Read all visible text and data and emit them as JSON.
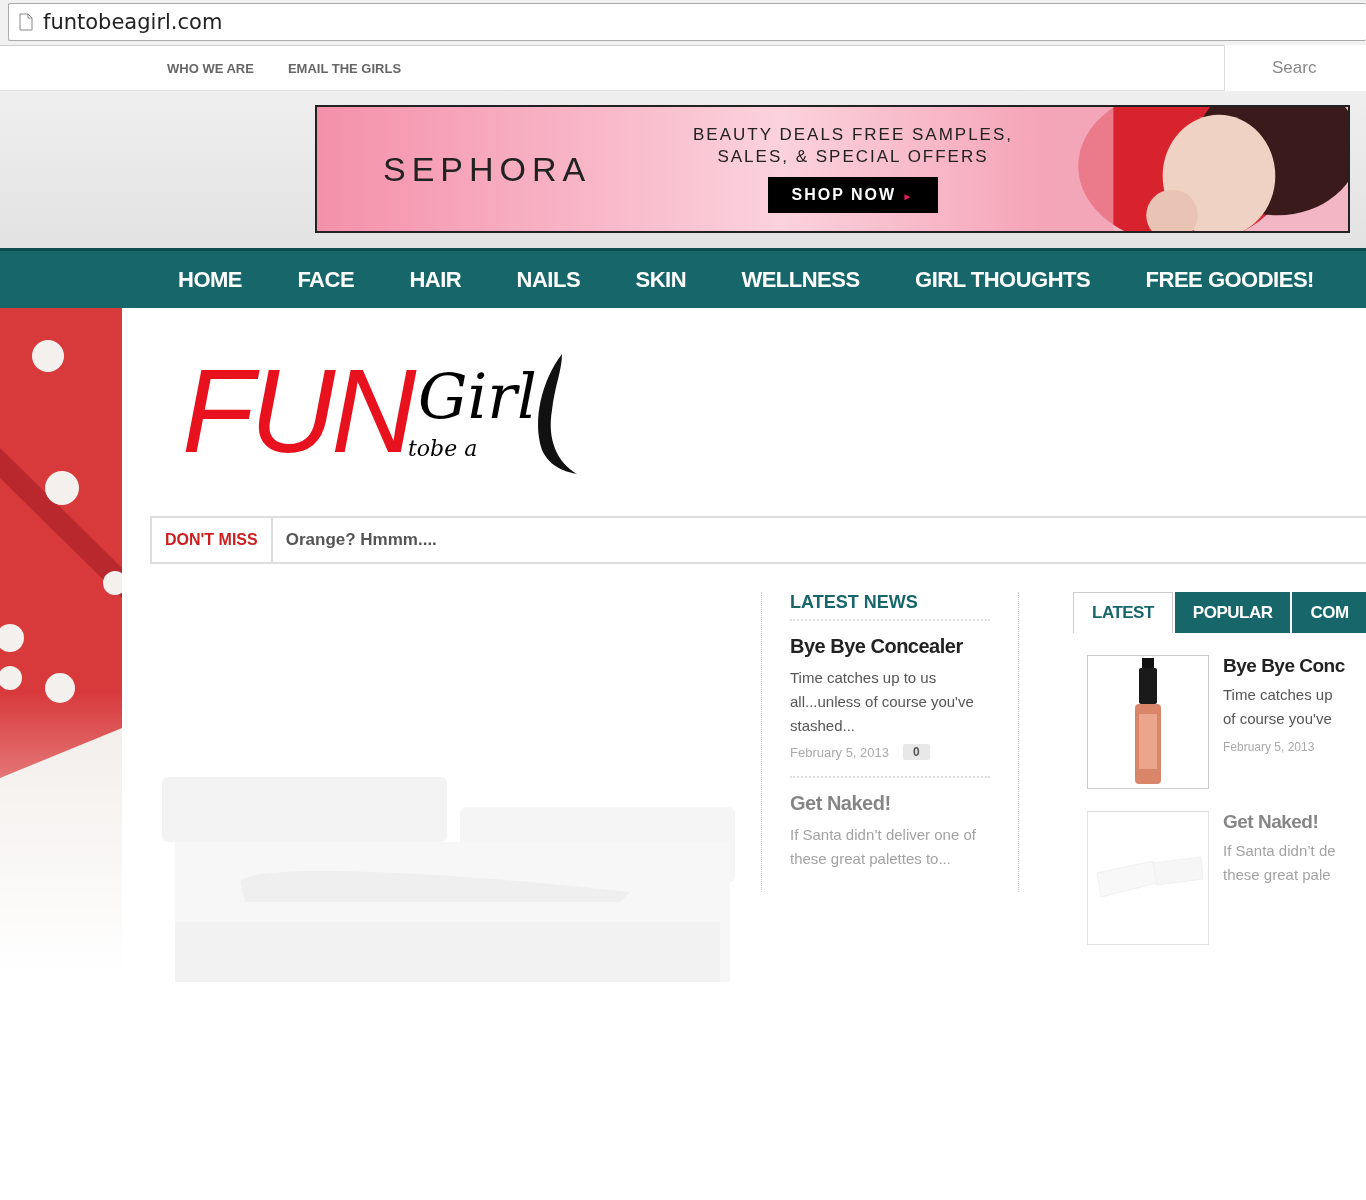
{
  "address_bar": {
    "url": "funtobeagirl.com"
  },
  "top_nav": {
    "links": [
      "WHO WE ARE",
      "EMAIL THE GIRLS"
    ],
    "search": {
      "placeholder": "Searc"
    }
  },
  "banner": {
    "brand": "SEPHORA",
    "headline": [
      "BEAUTY DEALS FREE SAMPLES,",
      "SALES, & SPECIAL OFFERS"
    ],
    "button": "SHOP NOW",
    "button_arrow": "►"
  },
  "main_nav": [
    "HOME",
    "FACE",
    "HAIR",
    "NAILS",
    "SKIN",
    "WELLNESS",
    "GIRL THOUGHTS",
    "FREE GOODIES!"
  ],
  "logo": {
    "big": "FUN",
    "small": "tobe a",
    "script": "Girl"
  },
  "ticker": {
    "label": "DON'T MISS",
    "text": "Orange? Hmmm...."
  },
  "latest_news": {
    "title": "LATEST NEWS",
    "posts": [
      {
        "title": "Bye Bye Concealer",
        "excerpt": "Time catches up to us all...unless of course you've stashed...",
        "date": "February 5, 2013",
        "comments": "0",
        "faded": false
      },
      {
        "title": "Get Naked!",
        "excerpt": "If Santa didn’t deliver one of these great palettes to...",
        "faded": true
      }
    ]
  },
  "tabs_widget": {
    "tabs": [
      {
        "label": "LATEST",
        "selected": true
      },
      {
        "label": "POPULAR",
        "selected": false
      },
      {
        "label": "COM",
        "selected": false
      }
    ],
    "posts": [
      {
        "title": "Bye Bye Conc",
        "excerpt": "Time catches up\nof course you've",
        "date": "February 5, 2013",
        "kind": "bottle",
        "faded": false
      },
      {
        "title": "Get Naked!",
        "excerpt": "If Santa didn’t de\nthese great pale",
        "kind": "palette",
        "faded": true
      }
    ]
  }
}
